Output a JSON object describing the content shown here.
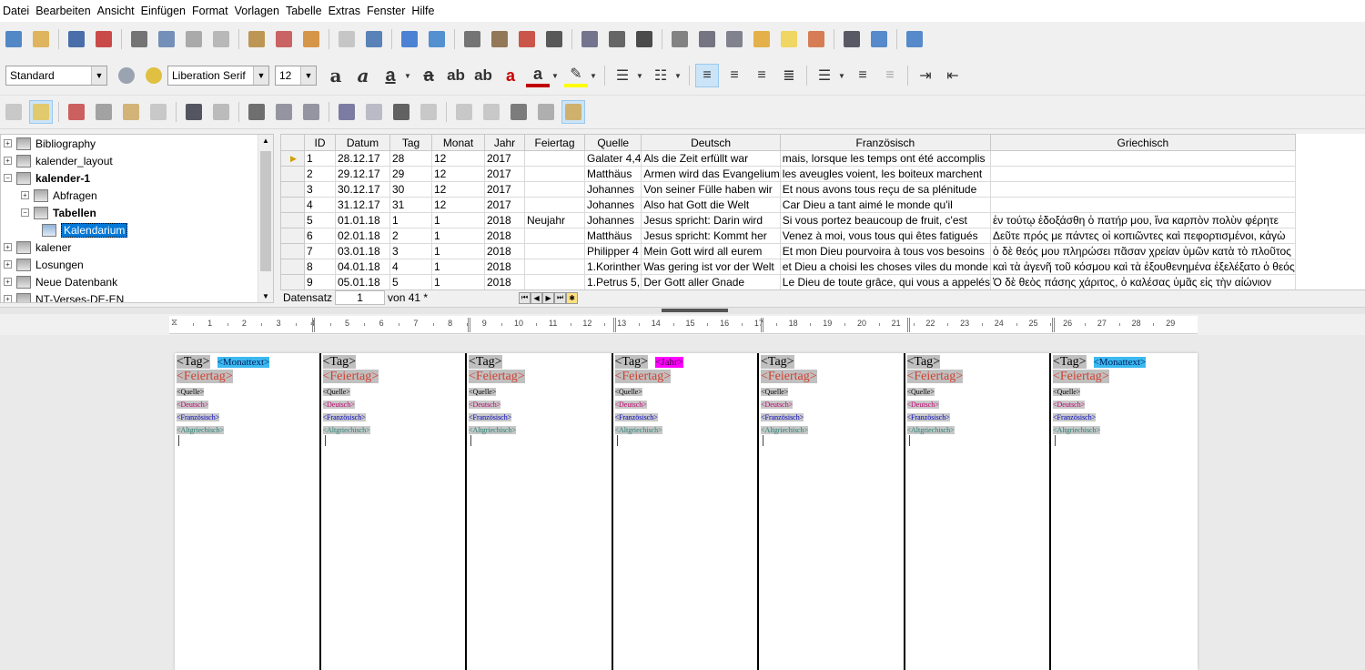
{
  "menubar": [
    "Datei",
    "Bearbeiten",
    "Ansicht",
    "Einfügen",
    "Format",
    "Vorlagen",
    "Tabelle",
    "Extras",
    "Fenster",
    "Hilfe"
  ],
  "formatbar": {
    "style": "Standard",
    "font": "Liberation Serif",
    "size": "12"
  },
  "icons": {
    "toolbar1": [
      "new-document-icon",
      "open-folder-icon",
      "save-icon",
      "export-pdf-icon",
      "print-icon",
      "print-preview-icon",
      "cut-icon",
      "copy-icon",
      "paste-icon",
      "clone-formatting-icon",
      "undo-icon",
      "redo-icon",
      "find-replace-icon",
      "spellcheck-icon",
      "formatting-marks-icon",
      "insert-table-icon",
      "insert-image-icon",
      "insert-chart-icon",
      "insert-textbox-icon",
      "page-break-icon",
      "insert-field-icon",
      "special-character-icon",
      "hyperlink-icon",
      "footnote-icon",
      "endnote-icon",
      "bookmark-icon",
      "comment-icon",
      "track-changes-icon",
      "line-icon",
      "basic-shapes-icon",
      "navigator-icon"
    ],
    "toolbar3": [
      "save-record-icon",
      "edit-data-icon",
      "cut-icon",
      "copy-icon",
      "paste-icon",
      "undo-icon",
      "search-record-icon",
      "refresh-icon",
      "sort-icon",
      "sort-ascending-icon",
      "sort-descending-icon",
      "autofilter-icon",
      "standard-filter-icon",
      "apply-filter-icon",
      "reset-filter-icon",
      "data-to-text-icon",
      "data-to-fields-icon",
      "mail-merge-icon",
      "data-source-icon",
      "explorer-icon"
    ]
  },
  "tree": [
    {
      "label": "Bibliography",
      "level": 0,
      "expander": "+",
      "bold": false,
      "selected": false
    },
    {
      "label": "kalender_layout",
      "level": 0,
      "expander": "+",
      "bold": false,
      "selected": false
    },
    {
      "label": "kalender-1",
      "level": 0,
      "expander": "−",
      "bold": true,
      "selected": false
    },
    {
      "label": "Abfragen",
      "level": 1,
      "expander": "+",
      "bold": false,
      "selected": false
    },
    {
      "label": "Tabellen",
      "level": 1,
      "expander": "−",
      "bold": true,
      "selected": false
    },
    {
      "label": "Kalendarium",
      "level": 2,
      "expander": "",
      "bold": false,
      "selected": true
    },
    {
      "label": "kalener",
      "level": 0,
      "expander": "+",
      "bold": false,
      "selected": false
    },
    {
      "label": "Losungen",
      "level": 0,
      "expander": "+",
      "bold": false,
      "selected": false
    },
    {
      "label": "Neue Datenbank",
      "level": 0,
      "expander": "+",
      "bold": false,
      "selected": false
    },
    {
      "label": "NT-Verses-DE-EN",
      "level": 0,
      "expander": "+",
      "bold": false,
      "selected": false
    }
  ],
  "grid": {
    "columns": [
      "ID",
      "Datum",
      "Tag",
      "Monat",
      "Jahr",
      "Feiertag",
      "Quelle",
      "Deutsch",
      "Französisch",
      "Griechisch"
    ],
    "rows": [
      [
        "1",
        "28.12.17",
        "28",
        "12",
        "2017",
        "",
        "Galater 4,4",
        "Als die Zeit erfüllt war",
        "mais, lorsque les temps ont été accomplis",
        ""
      ],
      [
        "2",
        "29.12.17",
        "29",
        "12",
        "2017",
        "",
        "Matthäus",
        "Armen wird das Evangelium",
        "les aveugles voient, les boiteux marchent",
        ""
      ],
      [
        "3",
        "30.12.17",
        "30",
        "12",
        "2017",
        "",
        "Johannes",
        "Von seiner Fülle haben wir",
        "Et nous avons tous reçu de sa plénitude",
        ""
      ],
      [
        "4",
        "31.12.17",
        "31",
        "12",
        "2017",
        "",
        "Johannes",
        "Also hat Gott die Welt",
        "Car Dieu a tant aimé le monde qu'il",
        ""
      ],
      [
        "5",
        "01.01.18",
        "1",
        "1",
        "2018",
        "Neujahr",
        "Johannes",
        " Jesus spricht: Darin wird",
        "Si vous portez beaucoup de fruit, c'est",
        "ἐν τούτῳ ἐδοξάσθη ὁ πατήρ μου, ἵνα καρπὸν πολὺν φέρητε"
      ],
      [
        "6",
        "02.01.18",
        "2",
        "1",
        "2018",
        "",
        "Matthäus",
        " Jesus spricht: Kommt her",
        "Venez à moi, vous tous qui êtes fatigués",
        "Δεῦτε πρός με πάντες οἱ κοπιῶντες καὶ πεφορτισμένοι, κἀγὼ"
      ],
      [
        "7",
        "03.01.18",
        "3",
        "1",
        "2018",
        "",
        "Philipper 4",
        "Mein Gott wird all eurem",
        "Et mon Dieu pourvoira à tous vos besoins",
        "ὁ δὲ θεός μου πληρώσει πᾶσαν χρείαν ὑμῶν κατὰ τὸ πλοῦτος"
      ],
      [
        "8",
        "04.01.18",
        "4",
        "1",
        "2018",
        "",
        "1.Korinther",
        "Was gering ist vor der Welt",
        "et Dieu a choisi les choses viles du monde",
        "καὶ τὰ ἀγενῆ τοῦ κόσμου καὶ τὰ ἐξουθενημένα ἐξελέξατο ὁ θεός"
      ],
      [
        "9",
        "05.01.18",
        "5",
        "1",
        "2018",
        "",
        "1.Petrus 5,",
        "Der Gott aller Gnade",
        "Le Dieu de toute grâce, qui vous a appelés",
        "Ὁ δὲ θεὸς πάσης χάριτος, ὁ καλέσας ὑμᾶς εἰς τὴν αἰώνιον"
      ]
    ]
  },
  "recordnav": {
    "label": "Datensatz",
    "value": "1",
    "count": "von 41 *"
  },
  "ruler": {
    "numbers": [
      "1",
      "2",
      "3",
      "4",
      "5",
      "6",
      "7",
      "8",
      "9",
      "10",
      "11",
      "12",
      "13",
      "14",
      "15",
      "16",
      "17",
      "18",
      "19",
      "20",
      "21",
      "22",
      "23",
      "24",
      "25",
      "26",
      "27",
      "28",
      "29"
    ]
  },
  "columns": [
    {
      "tag": "<Tag>",
      "extra": "<Monattext>",
      "extra_kind": "mt"
    },
    {
      "tag": "<Tag>",
      "extra": "",
      "extra_kind": ""
    },
    {
      "tag": "<Tag>",
      "extra": "",
      "extra_kind": ""
    },
    {
      "tag": "<Tag>",
      "extra": "<Jahr>",
      "extra_kind": "jr"
    },
    {
      "tag": "<Tag>",
      "extra": "",
      "extra_kind": ""
    },
    {
      "tag": "<Tag>",
      "extra": "",
      "extra_kind": ""
    },
    {
      "tag": "<Tag>",
      "extra": "<Monattext>",
      "extra_kind": "mt"
    }
  ],
  "fields": {
    "feiertag": "<Feiertag>",
    "quelle": "<Quelle>",
    "deutsch": "<Deutsch>",
    "franz": "<Französisch>",
    "griech": "<Altgriechisch>"
  }
}
